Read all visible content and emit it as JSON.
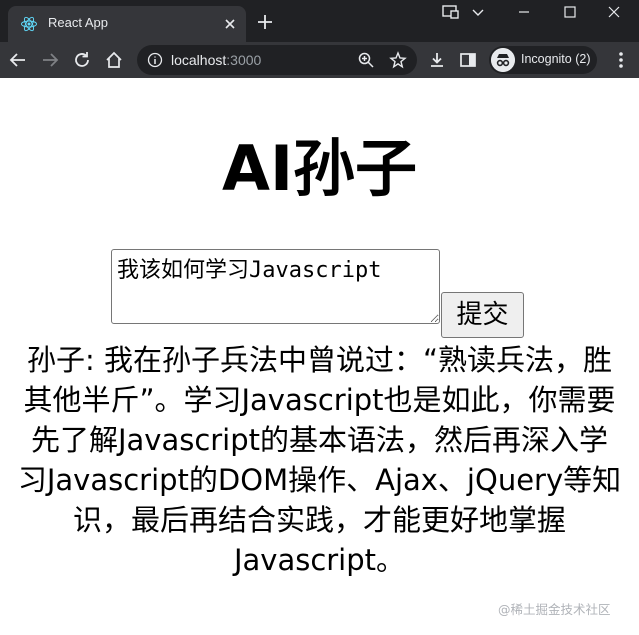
{
  "browser": {
    "tab": {
      "title": "React App"
    },
    "address": {
      "host": "localhost",
      "port": ":3000"
    },
    "profile": {
      "label": "Incognito (2)"
    }
  },
  "app": {
    "title": "AI孙子",
    "question": "我该如何学习Javascript",
    "submit_label": "提交",
    "answer_lines": [
      "孙子: 我在孙子兵法中曾说过：“熟读兵法，胜",
      "其他半斤”。学习Javascript也是如此，你需要",
      "先了解Javascript的基本语法，然后再深入学",
      "习Javascript的DOM操作、Ajax、jQuery等知",
      "识，最后再结合实践，才能更好地掌握",
      "Javascript。"
    ]
  },
  "watermark": "@稀土掘金技术社区",
  "colors": {
    "tabbar_bg": "#202124",
    "toolbar_bg": "#35363a",
    "omnibox_bg": "#202124",
    "react_logo": "#61dafb",
    "button_bg": "#efefef"
  }
}
